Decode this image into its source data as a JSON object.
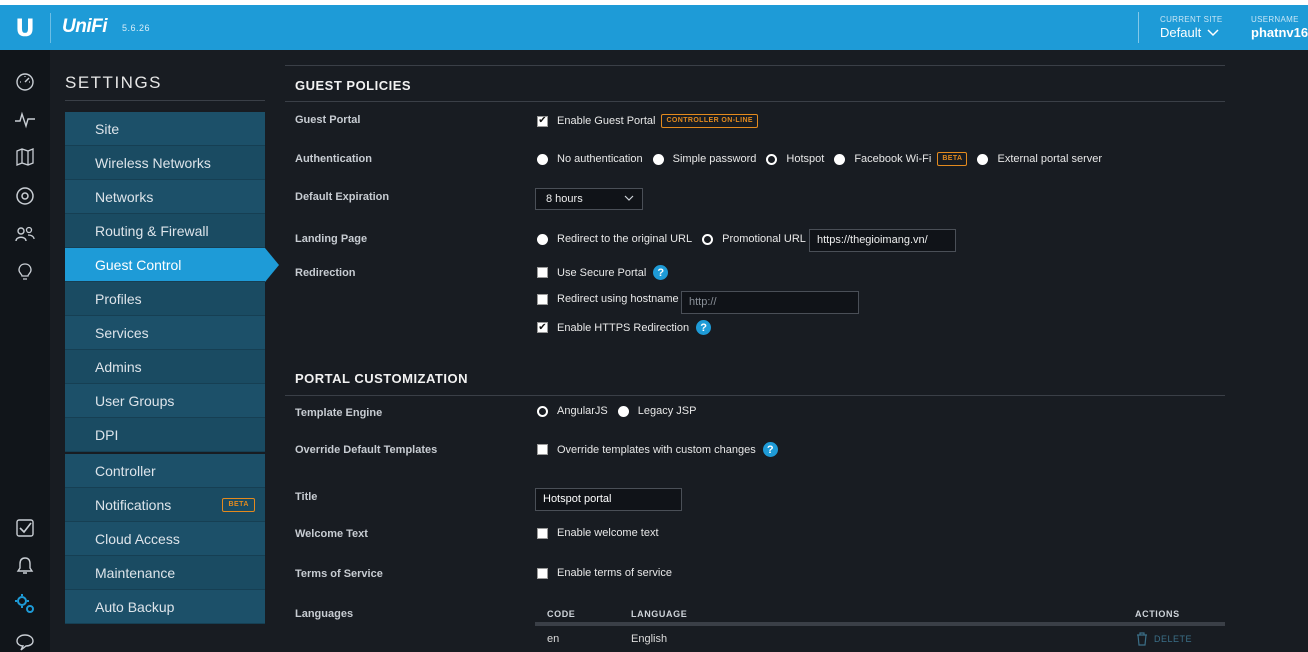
{
  "topbar": {
    "logo_glyph": "U",
    "brand": "UniFi",
    "version": "5.6.26",
    "current_site_label": "CURRENT SITE",
    "current_site_value": "Default",
    "username_label": "USERNAME",
    "username_value": "phatnv16"
  },
  "rail": {
    "icons": [
      "dashboard-icon",
      "statistics-icon",
      "map-icon",
      "devices-icon",
      "clients-icon",
      "insights-icon",
      "events-icon",
      "alerts-icon",
      "settings-icon",
      "chat-icon"
    ]
  },
  "settings": {
    "title": "SETTINGS",
    "group1": [
      "Site",
      "Wireless Networks",
      "Networks",
      "Routing & Firewall",
      "Guest Control",
      "Profiles",
      "Services",
      "Admins",
      "User Groups",
      "DPI"
    ],
    "group2": [
      "Controller",
      "Notifications",
      "Cloud Access",
      "Maintenance",
      "Auto Backup"
    ],
    "notifications_badge": "BETA",
    "active": "Guest Control"
  },
  "guest_policies": {
    "title": "GUEST POLICIES",
    "guest_portal_label": "Guest Portal",
    "enable_guest_portal": "Enable Guest Portal",
    "controller_tag": "CONTROLLER ON-LINE",
    "authentication_label": "Authentication",
    "auth_options": [
      "No authentication",
      "Simple password",
      "Hotspot",
      "Facebook Wi-Fi",
      "External portal server"
    ],
    "auth_selected": "Hotspot",
    "facebook_badge": "BETA",
    "default_expiration_label": "Default Expiration",
    "default_expiration_value": "8 hours",
    "landing_page_label": "Landing Page",
    "landing_redirect_original": "Redirect to the original URL",
    "landing_promotional": "Promotional URL",
    "landing_selected": "Promotional URL",
    "promotional_url_value": "https://thegioimang.vn/",
    "redirection_label": "Redirection",
    "use_secure_portal": "Use Secure Portal",
    "redirect_hostname": "Redirect using hostname",
    "hostname_placeholder": "http://",
    "enable_https_redirection": "Enable HTTPS Redirection"
  },
  "portal_customization": {
    "title": "PORTAL CUSTOMIZATION",
    "template_engine_label": "Template Engine",
    "template_options": [
      "AngularJS",
      "Legacy JSP"
    ],
    "template_selected": "AngularJS",
    "override_label": "Override Default Templates",
    "override_option": "Override templates with custom changes",
    "title_label": "Title",
    "title_value": "Hotspot portal",
    "welcome_text_label": "Welcome Text",
    "welcome_option": "Enable welcome text",
    "terms_label": "Terms of Service",
    "terms_option": "Enable terms of service",
    "languages_label": "Languages",
    "languages_table": {
      "columns": [
        "CODE",
        "LANGUAGE",
        "ACTIONS"
      ],
      "rows": [
        {
          "code": "en",
          "language": "English",
          "action": "DELETE"
        }
      ]
    }
  },
  "colors": {
    "accent": "#1e9bd7",
    "menu_bg": "#1a4b62",
    "page_bg": "#181c22",
    "badge": "#e38a1e"
  }
}
